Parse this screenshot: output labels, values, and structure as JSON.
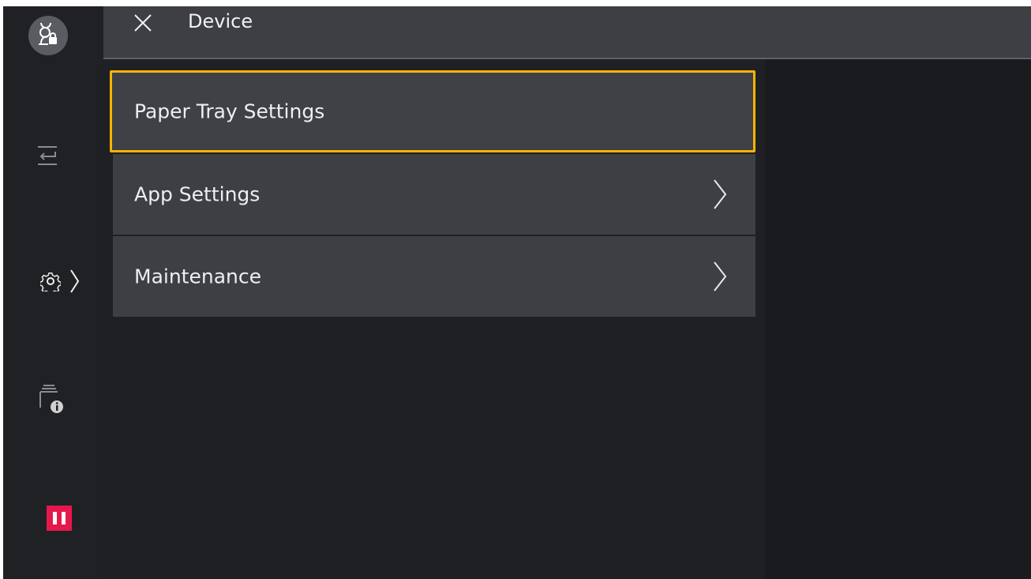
{
  "header": {
    "title": "Device"
  },
  "menu": {
    "items": [
      {
        "label": "Paper Tray Settings",
        "selected": true,
        "has_submenu": false
      },
      {
        "label": "App Settings",
        "selected": false,
        "has_submenu": true
      },
      {
        "label": "Maintenance",
        "selected": false,
        "has_submenu": true
      }
    ]
  },
  "rail": {
    "icons": [
      "user-lock-icon",
      "job-flow-icon",
      "gear-icon",
      "tray-info-icon",
      "pause-icon"
    ]
  },
  "colors": {
    "focus": "#f7b500",
    "pause": "#e6174c",
    "background": "#1a1b1f",
    "item": "#3e3f44"
  }
}
